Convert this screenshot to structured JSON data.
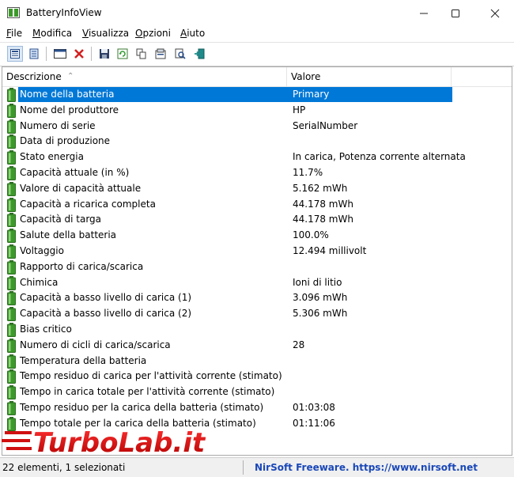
{
  "window": {
    "title": "BatteryInfoView"
  },
  "menu": [
    {
      "label": "File",
      "hotkey": "F",
      "rest": "ile"
    },
    {
      "label": "Modifica",
      "hotkey": "M",
      "rest": "odifica"
    },
    {
      "label": "Visualizza",
      "hotkey": "V",
      "rest": "isualizza"
    },
    {
      "label": "Opzioni",
      "hotkey": "O",
      "rest": "pzioni"
    },
    {
      "label": "Aiuto",
      "hotkey": "A",
      "rest": "iuto"
    }
  ],
  "table": {
    "headers": [
      "Descrizione",
      "Valore"
    ],
    "rows": [
      {
        "label": "Nome della batteria",
        "value": "Primary",
        "selected": true
      },
      {
        "label": "Nome del produttore",
        "value": "HP"
      },
      {
        "label": "Numero di serie",
        "value": "SerialNumber"
      },
      {
        "label": "Data di produzione",
        "value": ""
      },
      {
        "label": "Stato energia",
        "value": "In carica, Potenza corrente alternata"
      },
      {
        "label": "Capacità attuale (in %)",
        "value": "11.7%"
      },
      {
        "label": "Valore di capacità attuale",
        "value": "5.162 mWh"
      },
      {
        "label": "Capacità a ricarica completa",
        "value": "44.178 mWh"
      },
      {
        "label": "Capacità di targa",
        "value": "44.178 mWh"
      },
      {
        "label": "Salute della batteria",
        "value": "100.0%"
      },
      {
        "label": "Voltaggio",
        "value": "12.494 millivolt"
      },
      {
        "label": "Rapporto di carica/scarica",
        "value": ""
      },
      {
        "label": "Chimica",
        "value": "Ioni di litio"
      },
      {
        "label": "Capacità a basso livello di carica (1)",
        "value": "3.096 mWh"
      },
      {
        "label": "Capacità a basso livello di carica (2)",
        "value": "5.306 mWh"
      },
      {
        "label": "Bias critico",
        "value": ""
      },
      {
        "label": "Numero di cicli di carica/scarica",
        "value": "28"
      },
      {
        "label": "Temperatura della batteria",
        "value": ""
      },
      {
        "label": "Tempo residuo di carica per l'attività corrente (stimato)",
        "value": ""
      },
      {
        "label": "Tempo in carica totale per l'attività corrente (stimato)",
        "value": ""
      },
      {
        "label": "Tempo residuo per la carica della batteria (stimato)",
        "value": "01:03:08"
      },
      {
        "label": "Tempo totale per la carica della batteria (stimato)",
        "value": "01:11:06"
      }
    ]
  },
  "status": {
    "count": "22 elementi, 1 selezionati",
    "credit": "NirSoft Freeware. https://www.nirsoft.net"
  },
  "watermark": {
    "text": "TurboLab.it"
  },
  "colors": {
    "selection": "#0078d7",
    "link": "#1a48b8",
    "battery": "#3c9a2a"
  }
}
